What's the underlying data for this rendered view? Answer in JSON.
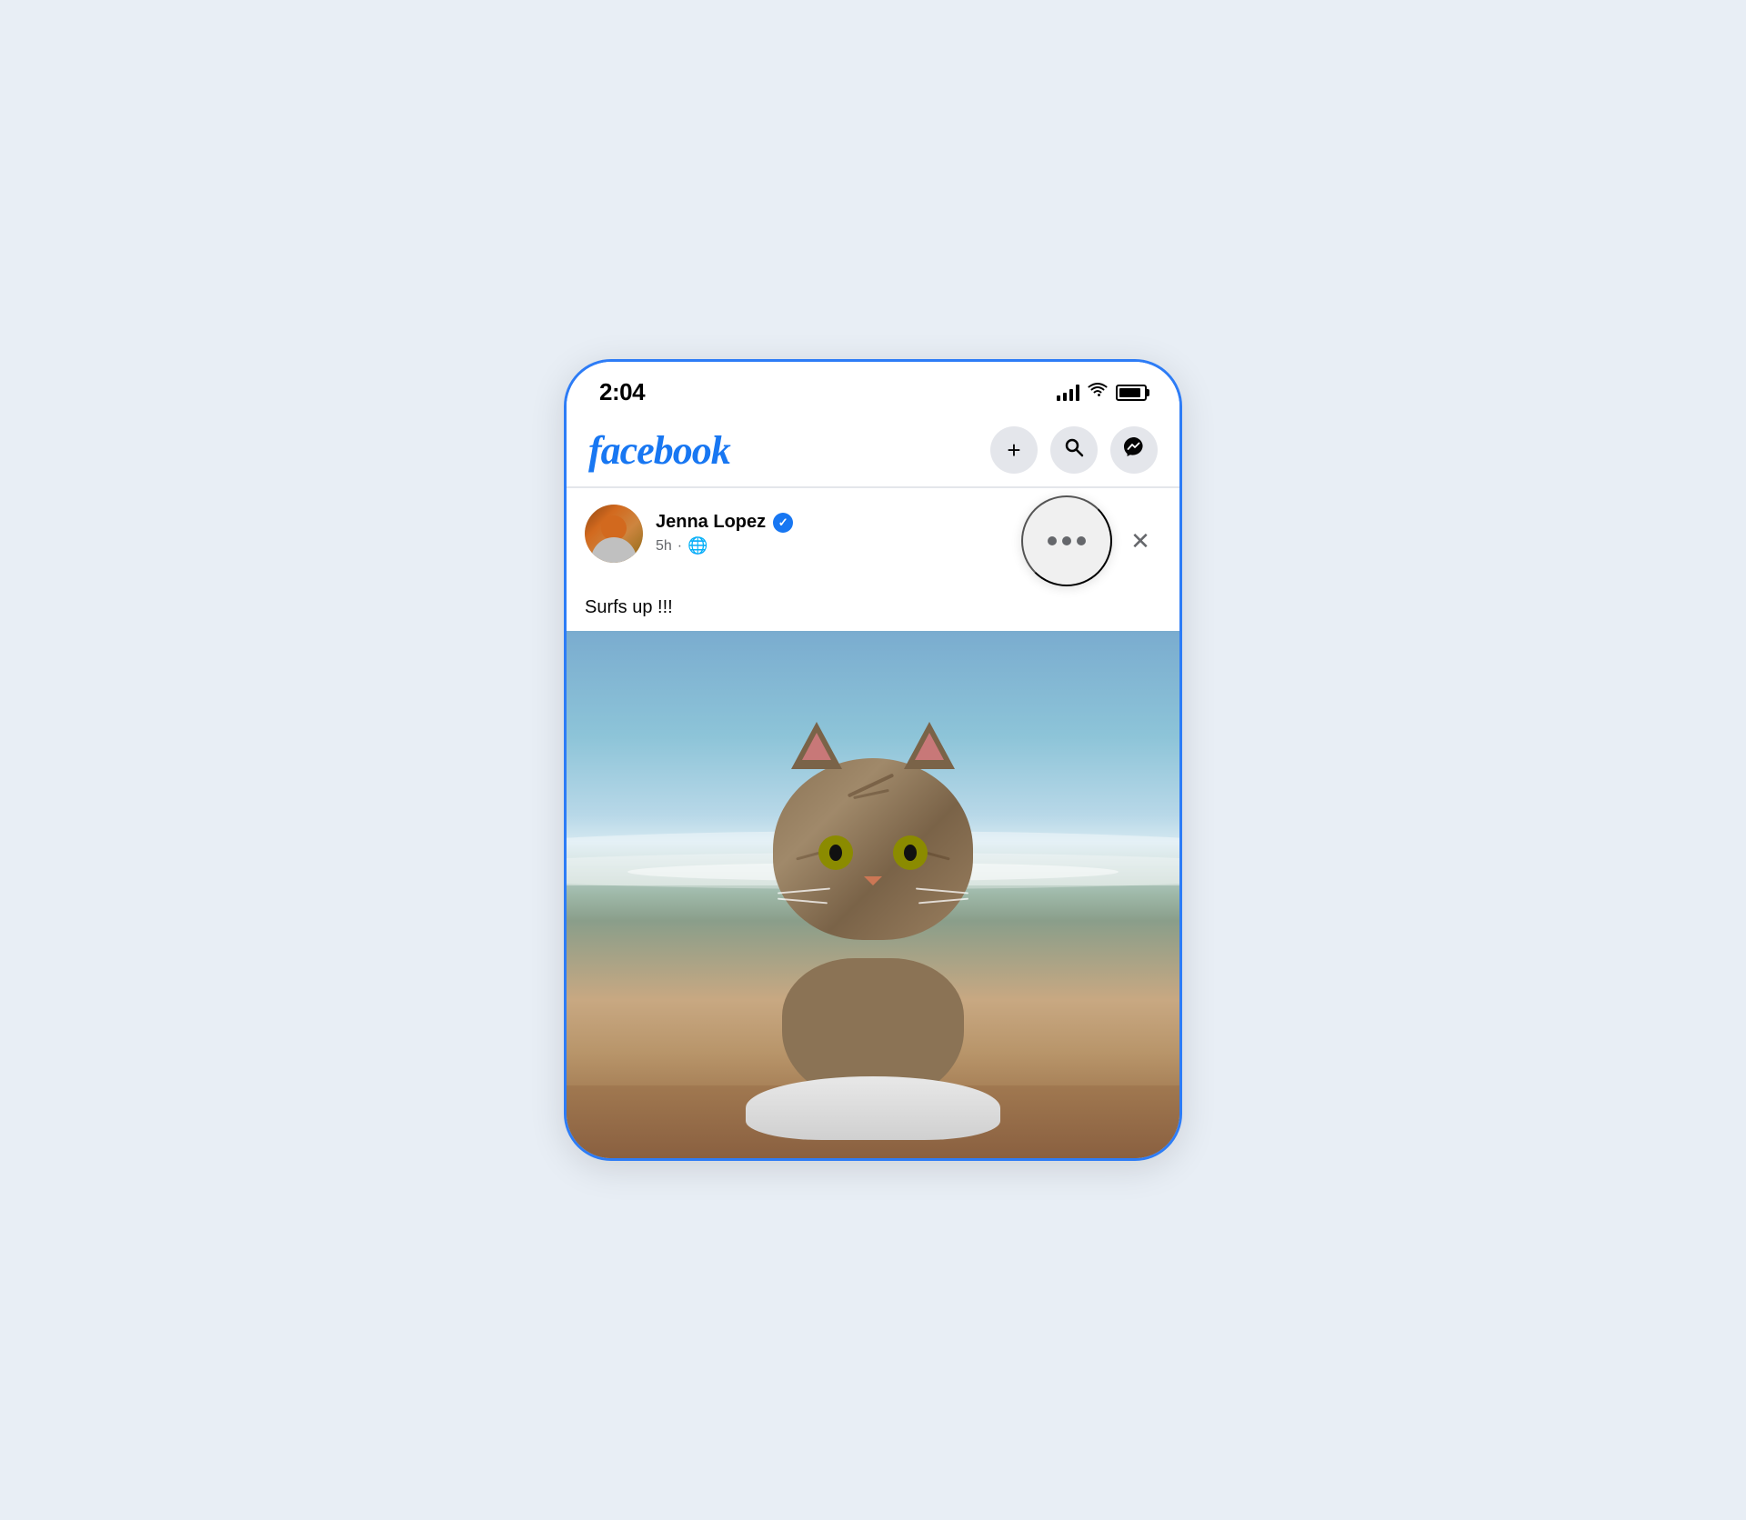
{
  "page": {
    "background_color": "#e8eef5"
  },
  "status_bar": {
    "time": "2:04",
    "signal_label": "signal",
    "wifi_label": "wifi",
    "battery_label": "battery"
  },
  "header": {
    "logo": "facebook",
    "add_button_label": "+",
    "search_button_label": "🔍",
    "messenger_button_label": "messenger"
  },
  "post": {
    "user_name": "Jenna Lopez",
    "verified": true,
    "verified_symbol": "✓",
    "time_ago": "5h",
    "globe_symbol": "🌐",
    "post_text": "Surfs up !!!",
    "more_options_label": "more options",
    "close_label": "✕",
    "image_alt": "Cat sitting on surfboard at the beach"
  }
}
